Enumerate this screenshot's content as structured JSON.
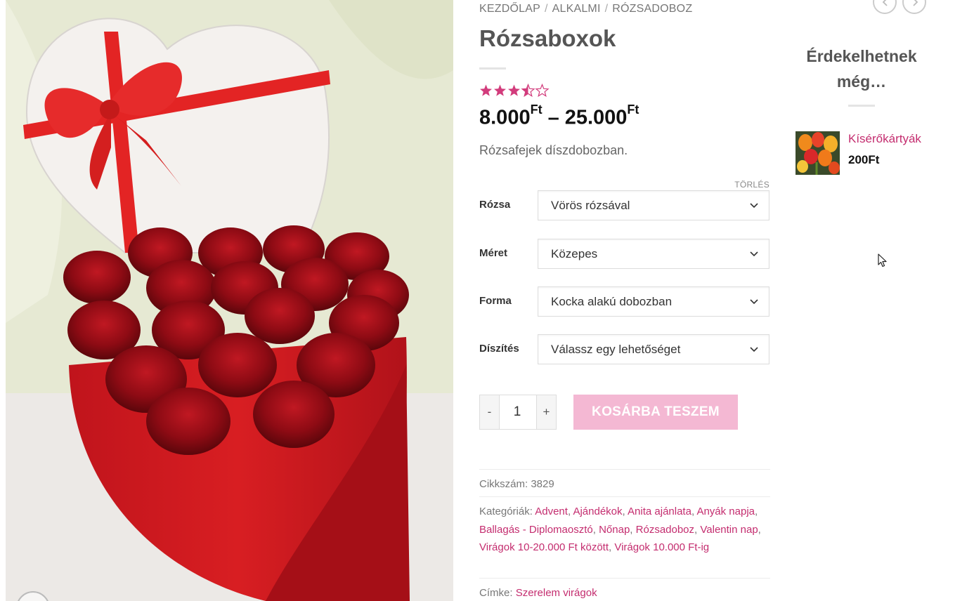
{
  "breadcrumb": {
    "items": [
      "KEZDŐLAP",
      "ALKALMI",
      "RÓZSADOBOZ"
    ],
    "separator": "/"
  },
  "product": {
    "title": "Rózsaboxok",
    "rating": 3.5,
    "rating_max": 5,
    "price_min": "8.000",
    "price_max": "25.000",
    "currency": "Ft",
    "price_dash": "–",
    "short_description": "Rózsafejek díszdobozban."
  },
  "variations": {
    "clear_label": "TÖRLÉS",
    "rows": [
      {
        "label": "Rózsa",
        "value": "Vörös rózsával"
      },
      {
        "label": "Méret",
        "value": "Közepes"
      },
      {
        "label": "Forma",
        "value": "Kocka alakú dobozban"
      },
      {
        "label": "Díszítés",
        "value": "Válassz egy lehetőséget"
      }
    ]
  },
  "cart": {
    "minus": "-",
    "quantity": "1",
    "plus": "+",
    "add_to_cart": "KOSÁRBA TESZEM"
  },
  "meta": {
    "sku_label": "Cikkszám:",
    "sku": "3829",
    "categories_label": "Kategóriák:",
    "categories": [
      "Advent",
      "Ajándékok",
      "Anita ajánlata",
      "Anyák napja",
      "Ballagás - Diplomaosztó",
      "Nőnap",
      "Rózsadoboz",
      "Valentin nap",
      "Virágok 10-20.000 Ft között",
      "Virágok 10.000 Ft-ig"
    ],
    "tag_label": "Címke:",
    "tag": "Szerelem virágok"
  },
  "sidebar": {
    "title_line1": "Érdekelhetnek",
    "title_line2": "még…",
    "item_name": "Kísérőkártyák",
    "item_price": "200Ft"
  },
  "colors": {
    "accent": "#c42d6f",
    "star": "#d23c7c",
    "button": "#f4b8d3"
  }
}
